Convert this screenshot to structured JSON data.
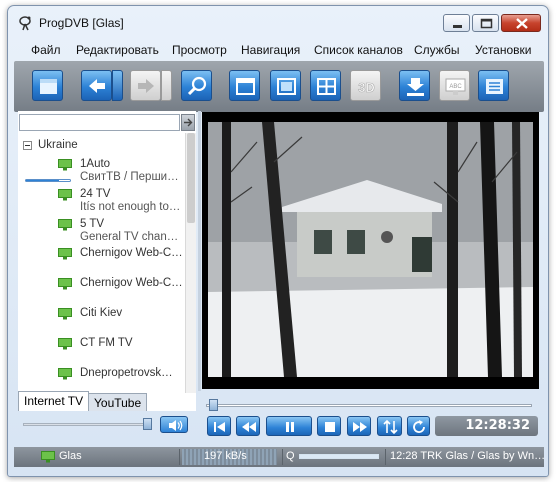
{
  "window": {
    "title": "ProgDVB [Glas]",
    "controls": [
      "minimize-icon",
      "maximize-icon",
      "close-icon"
    ]
  },
  "menu": {
    "items": [
      "Файл",
      "Редактировать",
      "Просмотр",
      "Навигация",
      "Список каналов",
      "Службы",
      "Установки"
    ]
  },
  "toolbar": {
    "buttons": [
      {
        "icon": "channel-list-icon",
        "enabled": true
      },
      {
        "icon": "back-arrow-icon",
        "enabled": true,
        "dropdown": true
      },
      {
        "icon": "forward-arrow-icon",
        "enabled": false,
        "dropdown": true
      },
      {
        "icon": "search-icon",
        "enabled": true
      },
      {
        "icon": "window-mode-icon",
        "enabled": true
      },
      {
        "icon": "fullscreen-icon",
        "enabled": true
      },
      {
        "icon": "grid-mosaic-icon",
        "enabled": true
      },
      {
        "icon": "3d-icon",
        "enabled": false,
        "label": "3D"
      },
      {
        "icon": "record-download-icon",
        "enabled": true
      },
      {
        "icon": "teletext-icon",
        "enabled": false,
        "label": "ABC"
      },
      {
        "icon": "epg-list-icon",
        "enabled": true
      }
    ]
  },
  "channel_panel": {
    "search_value": "",
    "group": "Ukraine",
    "channels": [
      {
        "name": "1Auto",
        "subtitle": "СвитТВ / Перши…"
      },
      {
        "name": "24 TV",
        "subtitle": "Itís not enough to…"
      },
      {
        "name": "5 TV",
        "subtitle": "General TV chan…"
      },
      {
        "name": "Chernigov Web-C…",
        "subtitle": ""
      },
      {
        "name": "Chernigov Web-C…",
        "subtitle": ""
      },
      {
        "name": "Citi Kiev",
        "subtitle": ""
      },
      {
        "name": "CT FM TV",
        "subtitle": ""
      },
      {
        "name": "Dnepropetrovsk…",
        "subtitle": ""
      }
    ],
    "first_channel_progress": 0.75,
    "tabs": [
      {
        "label": "Internet TV",
        "active": true
      },
      {
        "label": "YouTube",
        "active": false
      }
    ],
    "volume": 0.95
  },
  "player": {
    "seek_position": 0.0,
    "time": "12:28:32",
    "buttons": [
      "skip-back-icon",
      "rewind-icon",
      "pause-icon",
      "stop-icon",
      "fast-forward-icon",
      "audio-tracks-icon",
      "refresh-icon"
    ]
  },
  "status": {
    "channel": "Glas",
    "bitrate": "197 kB/s",
    "quality_label": "Q",
    "quality": 1.0,
    "info": "12:28 TRK Glas / Glas by Wn…"
  },
  "colors": {
    "accent_blue": "#2d82d6",
    "toolbar_gray": "#8a9199",
    "channel_icon_green": "#3fae2a"
  }
}
